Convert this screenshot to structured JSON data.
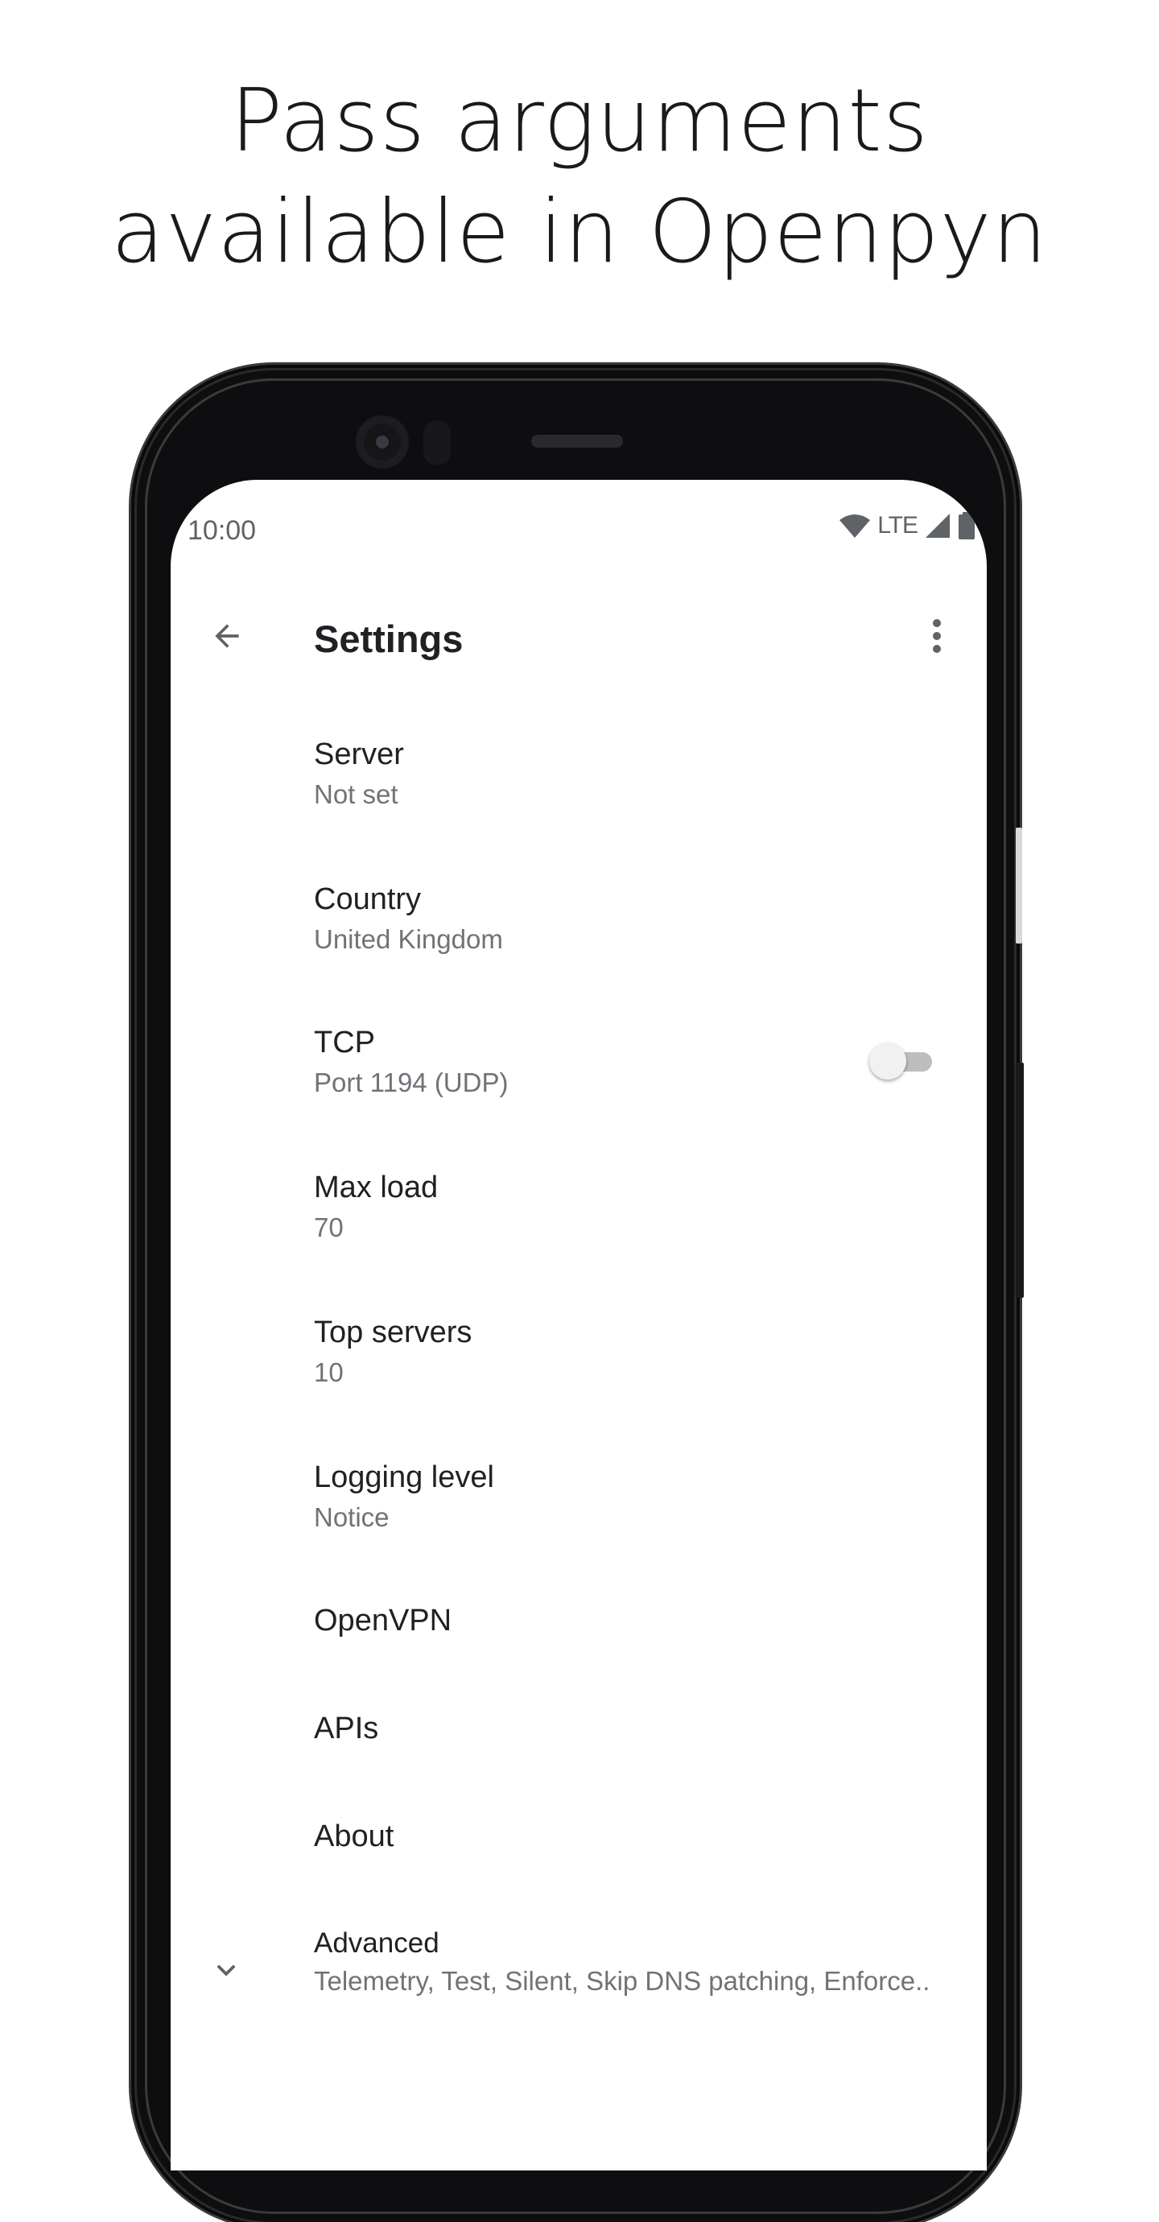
{
  "headline": {
    "line1": "Pass arguments",
    "line2": "available in Openpyn"
  },
  "status_bar": {
    "time": "10:00",
    "network": "LTE",
    "icons": [
      "wifi-icon",
      "cellular-signal-icon",
      "battery-icon"
    ]
  },
  "app_bar": {
    "title": "Settings",
    "icons": [
      "back-arrow-icon",
      "more-vert-icon"
    ]
  },
  "preferences": [
    {
      "title": "Server",
      "summary": "Not set"
    },
    {
      "title": "Country",
      "summary": "United Kingdom"
    },
    {
      "title": "TCP",
      "summary": "Port 1194 (UDP)",
      "switch_on": false
    },
    {
      "title": "Max load",
      "summary": "70"
    },
    {
      "title": "Top servers",
      "summary": "10"
    },
    {
      "title": "Logging level",
      "summary": "Notice"
    },
    {
      "title": "OpenVPN"
    },
    {
      "title": "APIs"
    },
    {
      "title": "About"
    },
    {
      "title": "Advanced",
      "summary": "Telemetry, Test, Silent, Skip DNS patching, Enforce..",
      "icon": "chevron-down-icon"
    }
  ],
  "colors": {
    "text_primary": "#202124",
    "text_secondary": "#6f7377",
    "phone_body": "#0e0e10"
  }
}
